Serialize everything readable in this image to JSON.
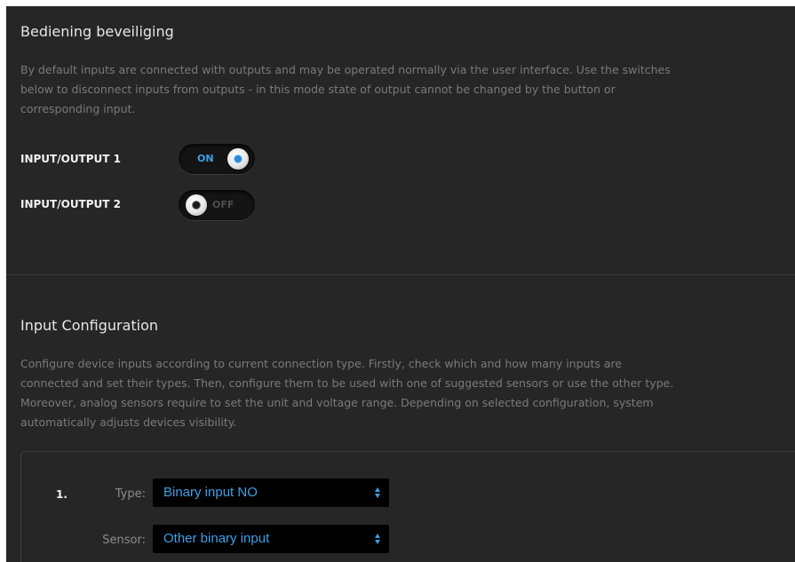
{
  "protection": {
    "title": "Bediening beveiliging",
    "description_lines": [
      "By default inputs are connected with outputs and may be operated normally via the user interface. Use the switches",
      "below to disconnect inputs from outputs - in this mode state of output cannot be changed by the button or",
      "corresponding input."
    ],
    "items": [
      {
        "label": "INPUT/OUTPUT 1",
        "state": "ON",
        "on": true
      },
      {
        "label": "INPUT/OUTPUT 2",
        "state": "OFF",
        "on": false
      }
    ]
  },
  "input_config": {
    "title": "Input Configuration",
    "description_lines": [
      "Configure device inputs according to current connection type. Firstly, check which and how many inputs are",
      "connected and set their types. Then, configure them to be used with one of suggested sensors or use the other type.",
      "Moreover, analog sensors require to set the unit and voltage range. Depending on selected configuration, system",
      "automatically adjusts devices visibility."
    ],
    "rows": [
      {
        "number": "1.",
        "type_label": "Type:",
        "type_value": "Binary input NO",
        "sensor_label": "Sensor:",
        "sensor_value": "Other binary input"
      }
    ]
  },
  "colors": {
    "background": "#262626",
    "accent": "#3aa0e8",
    "heading": "#e6e6e6",
    "description": "#7a7a7a"
  },
  "icons": {
    "select_arrows": "up-down-arrows-icon",
    "toggle_knob": "toggle-knob-icon"
  }
}
